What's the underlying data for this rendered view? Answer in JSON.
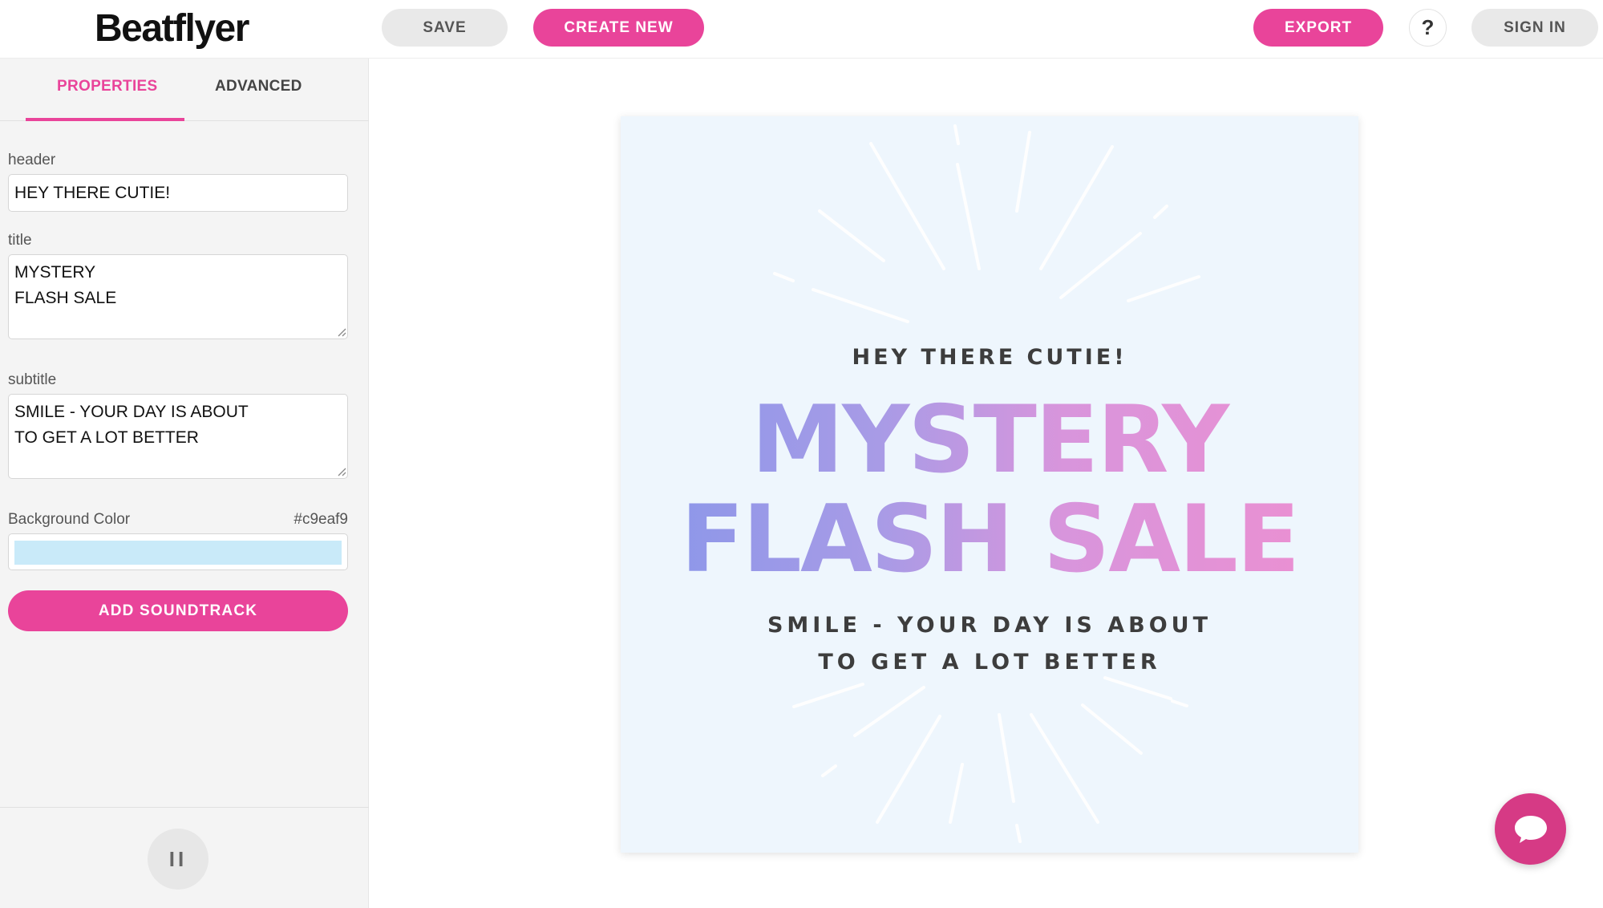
{
  "app": {
    "logo": "Beatflyer"
  },
  "toolbar": {
    "save_label": "SAVE",
    "create_label": "CREATE NEW",
    "export_label": "EXPORT",
    "help_label": "?",
    "signin_label": "SIGN IN"
  },
  "sidebar": {
    "tabs": [
      {
        "label": "PROPERTIES",
        "active": true
      },
      {
        "label": "ADVANCED",
        "active": false
      }
    ],
    "fields": {
      "header": {
        "label": "header",
        "value": "HEY THERE CUTIE!"
      },
      "title": {
        "label": "title",
        "value": "MYSTERY\nFLASH SALE"
      },
      "subtitle": {
        "label": "subtitle",
        "value": "SMILE - YOUR DAY IS ABOUT\nTO GET A LOT BETTER"
      },
      "background_color": {
        "label": "Background Color",
        "value": "#c9eaf9"
      }
    },
    "add_soundtrack_label": "ADD SOUNDTRACK",
    "playback": {
      "icon": "pause-icon",
      "label": "II"
    }
  },
  "flyer": {
    "header": "HEY THERE CUTIE!",
    "title": "MYSTERY\nFLASH SALE",
    "subtitle": "SMILE - YOUR DAY IS ABOUT\nTO GET A LOT BETTER",
    "background": "#eef6fd",
    "gradient_colors": [
      "#8796ea",
      "#ee8fd0"
    ]
  },
  "chat": {
    "icon": "chat-bubble-icon"
  },
  "colors": {
    "accent": "#e9449a",
    "chat": "#d63a85"
  }
}
